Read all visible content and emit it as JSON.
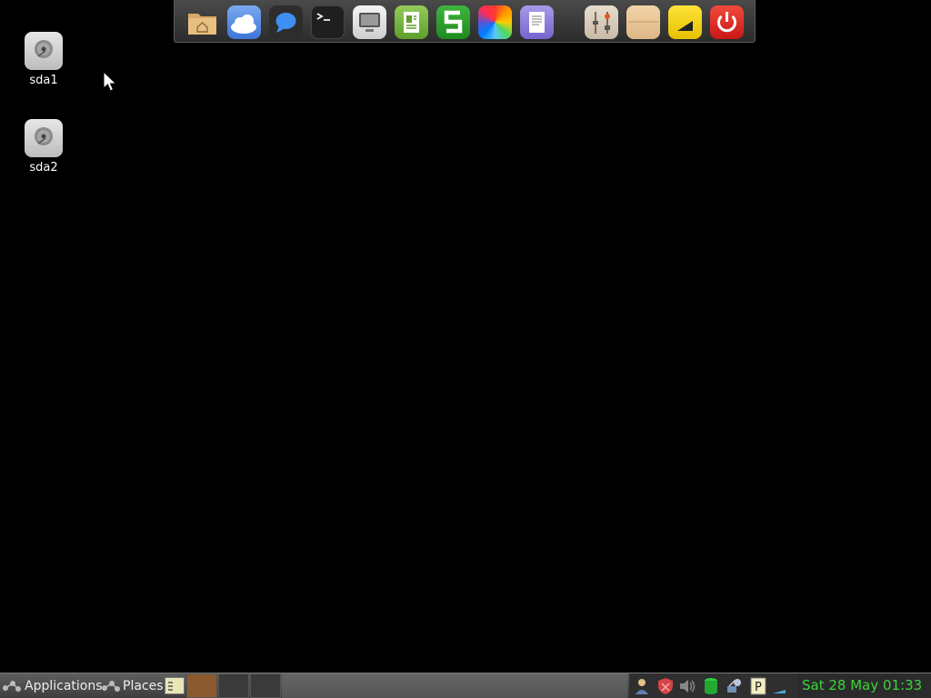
{
  "desktop": {
    "drives": [
      {
        "label": "sda1",
        "icon": "hard-drive-icon"
      },
      {
        "label": "sda2",
        "icon": "hard-drive-icon"
      }
    ]
  },
  "dock": {
    "items": [
      {
        "name": "home-folder-icon"
      },
      {
        "name": "cloud-icon"
      },
      {
        "name": "chat-icon"
      },
      {
        "name": "terminal-icon"
      },
      {
        "name": "computer-icon"
      },
      {
        "name": "document-viewer-icon"
      },
      {
        "name": "spreadsheet-icon"
      },
      {
        "name": "color-wheel-icon"
      },
      {
        "name": "text-editor-icon"
      },
      {
        "name": "settings-sliders-icon"
      },
      {
        "name": "file-manager-icon"
      },
      {
        "name": "wifi-signal-icon"
      },
      {
        "name": "power-icon"
      }
    ]
  },
  "taskbar": {
    "applications_label": "Applications",
    "places_label": "Places",
    "clock": "Sat 28 May 01:33",
    "tray": [
      {
        "name": "user-icon"
      },
      {
        "name": "shield-icon"
      },
      {
        "name": "volume-icon"
      },
      {
        "name": "database-icon"
      },
      {
        "name": "network-icon"
      },
      {
        "name": "p-icon"
      }
    ]
  },
  "colors": {
    "clock": "#3bd43b",
    "power": "#e02020",
    "accent_yellow": "#f2d41c"
  }
}
